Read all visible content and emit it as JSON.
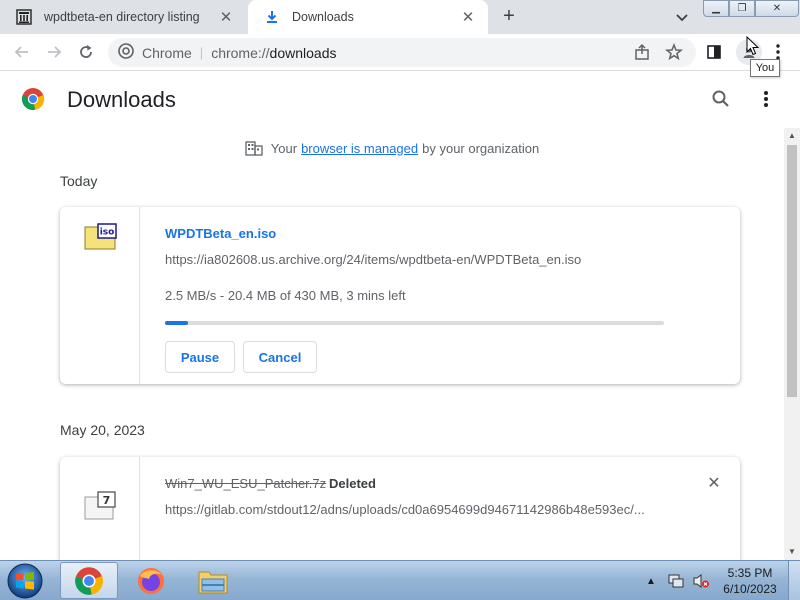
{
  "tabs": [
    {
      "title": "wpdtbeta-en directory listing",
      "icon": "archive-icon",
      "active": false
    },
    {
      "title": "Downloads",
      "icon": "download-icon",
      "active": true
    }
  ],
  "toolbar": {
    "omnibox_site_label": "Chrome",
    "url_scheme": "chrome://",
    "url_path": "downloads",
    "tooltip": "You"
  },
  "page": {
    "title": "Downloads",
    "managed_prefix": "Your",
    "managed_link": "browser is managed",
    "managed_suffix": "by your organization"
  },
  "sections": [
    {
      "date": "Today",
      "item": {
        "file_name": "WPDTBeta_en.iso",
        "url": "https://ia802608.us.archive.org/24/items/wpdtbeta-en/WPDTBeta_en.iso",
        "status": "2.5 MB/s - 20.4 MB of 430 MB, 3 mins left",
        "progress_fraction": 0.047,
        "pause_label": "Pause",
        "cancel_label": "Cancel",
        "icon": "iso-file-icon"
      }
    },
    {
      "date": "May 20, 2023",
      "item": {
        "file_name": "Win7_WU_ESU_Patcher.7z",
        "deleted_label": "Deleted",
        "url": "https://gitlab.com/stdout12/adns/uploads/cd0a6954699d94671142986b48e593ec/...",
        "icon": "7z-file-icon"
      }
    }
  ],
  "taskbar": {
    "time": "5:35 PM",
    "date": "6/10/2023"
  },
  "colors": {
    "accent": "#1a73e8",
    "tabstrip": "#dee1e6",
    "taskbar": "#97b6d6"
  }
}
